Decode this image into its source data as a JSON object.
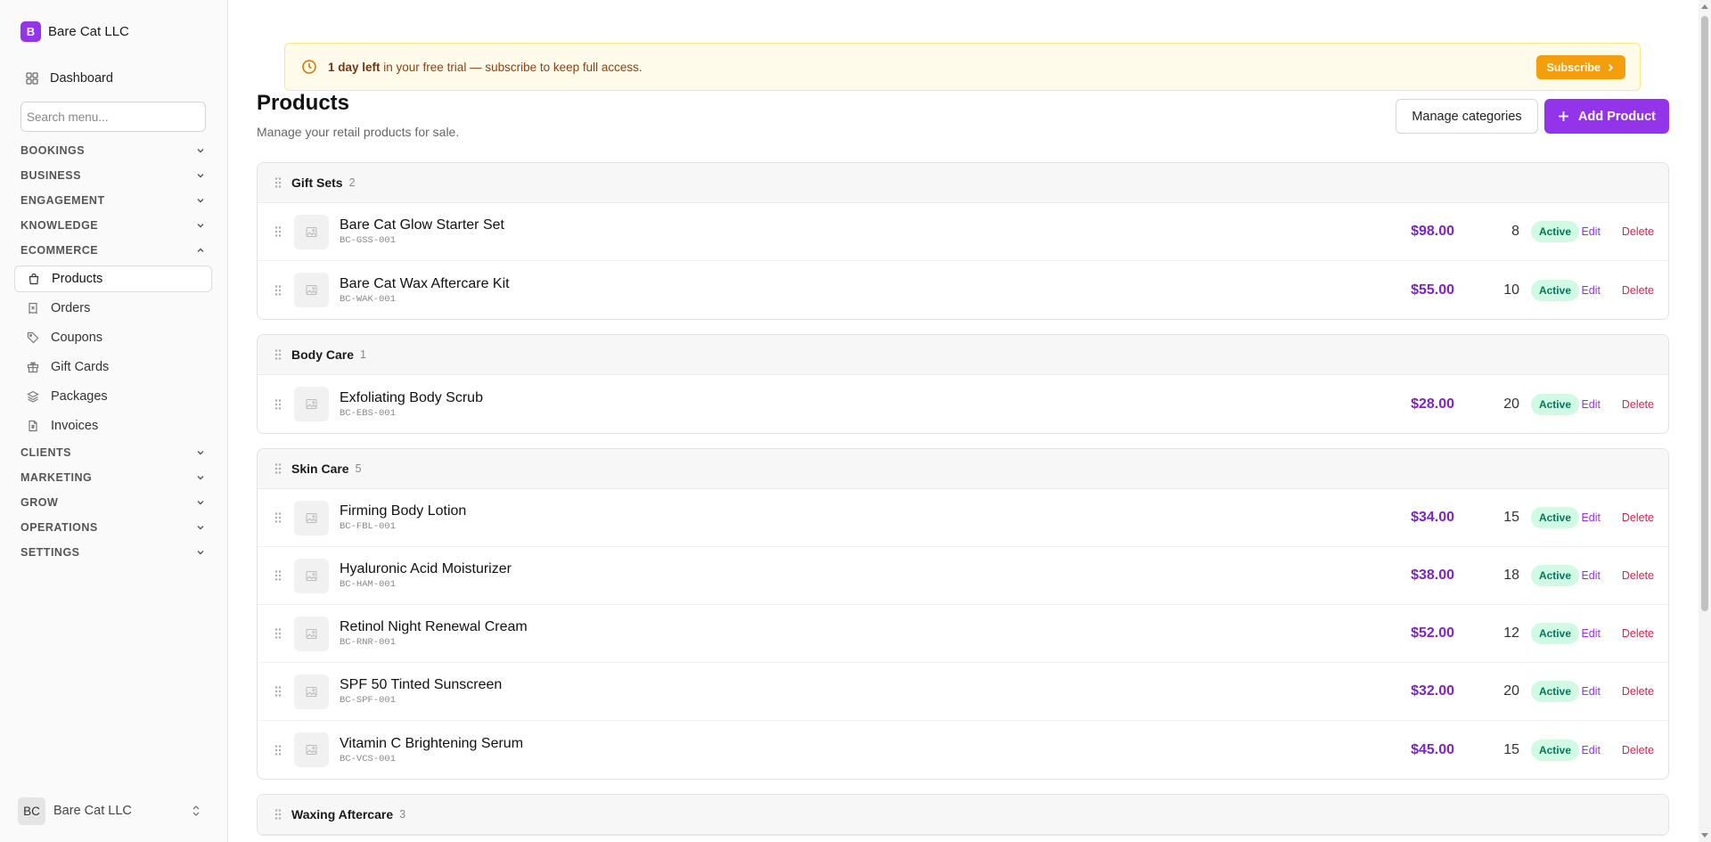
{
  "sidebar": {
    "org_initial": "B",
    "org_name": "Bare Cat LLC",
    "dashboard_label": "Dashboard",
    "search_placeholder": "Search menu...",
    "sections": {
      "bookings": "BOOKINGS",
      "business": "BUSINESS",
      "engagement": "ENGAGEMENT",
      "knowledge": "KNOWLEDGE",
      "ecommerce": "ECOMMERCE",
      "clients": "CLIENTS",
      "marketing": "MARKETING",
      "grow": "GROW",
      "operations": "OPERATIONS",
      "settings": "SETTINGS"
    },
    "ecommerce_items": {
      "products": "Products",
      "orders": "Orders",
      "coupons": "Coupons",
      "gift_cards": "Gift Cards",
      "packages": "Packages",
      "invoices": "Invoices"
    },
    "user_initials": "BC",
    "user_name": "Bare Cat LLC"
  },
  "trial": {
    "bold": "1 day left",
    "rest": " in your free trial — subscribe to keep full access.",
    "button": "Subscribe"
  },
  "header": {
    "title": "Products",
    "subtitle": "Manage your retail products for sale.",
    "manage_label": "Manage categories",
    "add_label": "Add Product"
  },
  "groups": [
    {
      "name": "Gift Sets",
      "count": "2",
      "products": [
        {
          "name": "Bare Cat Glow Starter Set",
          "sku": "BC-GSS-001",
          "price": "$98.00",
          "stock": "8",
          "status": "Active",
          "edit": "Edit",
          "delete": "Delete"
        },
        {
          "name": "Bare Cat Wax Aftercare Kit",
          "sku": "BC-WAK-001",
          "price": "$55.00",
          "stock": "10",
          "status": "Active",
          "edit": "Edit",
          "delete": "Delete"
        }
      ]
    },
    {
      "name": "Body Care",
      "count": "1",
      "products": [
        {
          "name": "Exfoliating Body Scrub",
          "sku": "BC-EBS-001",
          "price": "$28.00",
          "stock": "20",
          "status": "Active",
          "edit": "Edit",
          "delete": "Delete"
        }
      ]
    },
    {
      "name": "Skin Care",
      "count": "5",
      "products": [
        {
          "name": "Firming Body Lotion",
          "sku": "BC-FBL-001",
          "price": "$34.00",
          "stock": "15",
          "status": "Active",
          "edit": "Edit",
          "delete": "Delete"
        },
        {
          "name": "Hyaluronic Acid Moisturizer",
          "sku": "BC-HAM-001",
          "price": "$38.00",
          "stock": "18",
          "status": "Active",
          "edit": "Edit",
          "delete": "Delete"
        },
        {
          "name": "Retinol Night Renewal Cream",
          "sku": "BC-RNR-001",
          "price": "$52.00",
          "stock": "12",
          "status": "Active",
          "edit": "Edit",
          "delete": "Delete"
        },
        {
          "name": "SPF 50 Tinted Sunscreen",
          "sku": "BC-SPF-001",
          "price": "$32.00",
          "stock": "20",
          "status": "Active",
          "edit": "Edit",
          "delete": "Delete"
        },
        {
          "name": "Vitamin C Brightening Serum",
          "sku": "BC-VCS-001",
          "price": "$45.00",
          "stock": "15",
          "status": "Active",
          "edit": "Edit",
          "delete": "Delete"
        }
      ]
    },
    {
      "name": "Waxing Aftercare",
      "count": "3",
      "products": []
    }
  ],
  "colors": {
    "brand": "#9333ea",
    "price": "#7e22ce",
    "delete": "#e11d48",
    "active_badge_bg": "#d1fae5",
    "active_badge_text": "#047857",
    "trial_bg": "#fffbeb",
    "subscribe_bg": "#f59e0b"
  },
  "icons": {
    "dashboard": "grid-icon",
    "products": "shopping-bag-icon",
    "orders": "receipt-icon",
    "coupons": "tag-icon",
    "gift_cards": "gift-icon",
    "packages": "layers-icon",
    "invoices": "file-invoice-icon",
    "trial": "clock-icon",
    "thumb": "image-placeholder-icon",
    "drag": "drag-handle-icon"
  }
}
